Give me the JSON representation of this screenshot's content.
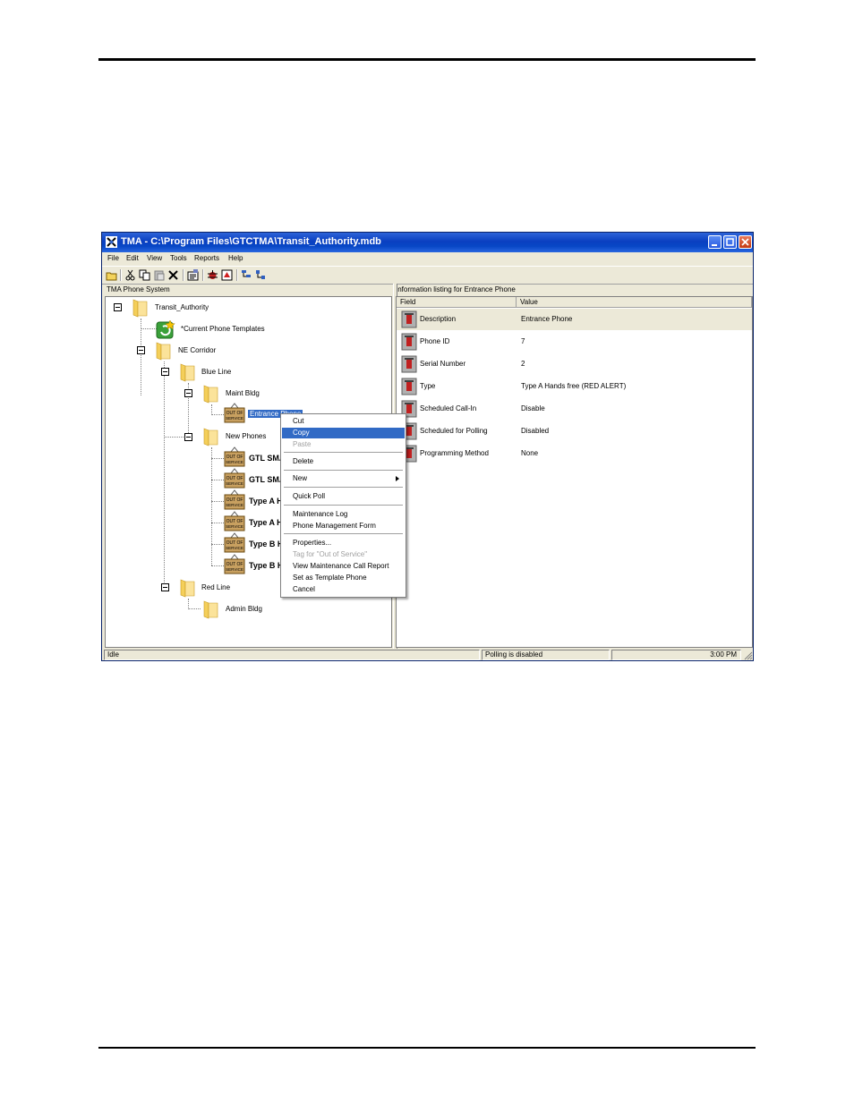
{
  "window": {
    "title": "TMA - C:\\Program Files\\GTCTMA\\Transit_Authority.mdb"
  },
  "menu": [
    "File",
    "Edit",
    "View",
    "Tools",
    "Reports",
    "Help"
  ],
  "left_header": "TMA Phone System",
  "right_header": "Information listing for Entrance Phone",
  "tree": {
    "root": "Transit_Authority",
    "templates": "*Current Phone Templates",
    "corridor": "NE Corridor",
    "blue_line": "Blue Line",
    "maint_bldg": "Maint Bldg",
    "entrance_phone": "Entrance Phone",
    "new_phones": "New Phones",
    "phones": [
      "GTL SMA",
      "GTL SMA",
      "Type A H",
      "Type A H",
      "Type B H",
      "Type B H"
    ],
    "red_line": "Red Line",
    "admin_bldg": "Admin Bldg"
  },
  "columns": {
    "field": "Field",
    "value": "Value"
  },
  "details": [
    {
      "field": "Description",
      "value": "Entrance Phone"
    },
    {
      "field": "Phone ID",
      "value": "7"
    },
    {
      "field": "Serial Number",
      "value": "2"
    },
    {
      "field": "Type",
      "value": "Type A Hands free (RED ALERT)"
    },
    {
      "field": "Scheduled Call-In",
      "value": "Disable"
    },
    {
      "field": "Scheduled for Polling",
      "value": "Disabled"
    },
    {
      "field": "Programming Method",
      "value": "None"
    }
  ],
  "context_menu": {
    "cut": "Cut",
    "copy": "Copy",
    "paste": "Paste",
    "delete": "Delete",
    "new": "New",
    "quick_poll": "Quick Poll",
    "maintenance_log": "Maintenance Log",
    "phone_management_form": "Phone Management Form",
    "properties": "Properties...",
    "tag_out_of_service": "Tag for \"Out of Service\"",
    "view_maintenance_report": "View Maintenance Call Report",
    "set_as_template": "Set as Template Phone",
    "cancel": "Cancel"
  },
  "status": {
    "state": "Idle",
    "polling": "Polling is disabled",
    "time": "3:00 PM"
  },
  "sign_text": "OUT OF SERVICE"
}
